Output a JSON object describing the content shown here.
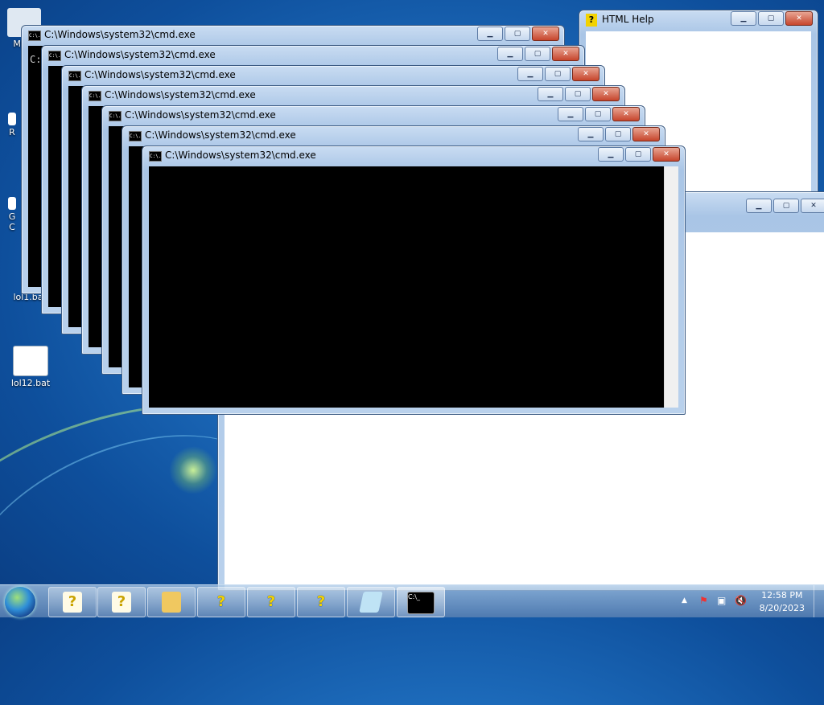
{
  "desktop": {
    "icons": [
      {
        "label": "My C"
      },
      {
        "label": "R"
      },
      {
        "label": "G"
      },
      {
        "label": "C"
      },
      {
        "label": "lol1.ba"
      },
      {
        "label": "lol12.bat"
      }
    ]
  },
  "cmd_windows": [
    {
      "title": "C:\\Windows\\system32\\cmd.exe",
      "prompt": "C:"
    },
    {
      "title": "C:\\Windows\\system32\\cmd.exe"
    },
    {
      "title": "C:\\Windows\\system32\\cmd.exe"
    },
    {
      "title": "C:\\Windows\\system32\\cmd.exe"
    },
    {
      "title": "C:\\Windows\\system32\\cmd.exe"
    },
    {
      "title": "C:\\Windows\\system32\\cmd.exe"
    },
    {
      "title": "C:\\Windows\\system32\\cmd.exe"
    }
  ],
  "html_help": {
    "title": "HTML Help"
  },
  "title_icon_text": "C:\\.",
  "colors": {
    "close_red": "#c7452c",
    "title_bg": "#b9d1ec",
    "console_bg": "#000000",
    "help_yellow": "#f2d200"
  },
  "taskbar": {
    "buttons": [
      {
        "icon": "help-file-icon",
        "glyph": "?"
      },
      {
        "icon": "help-file-icon",
        "glyph": "?"
      },
      {
        "icon": "file-explorer-icon",
        "glyph": ""
      },
      {
        "icon": "help-question-icon",
        "glyph": "?"
      },
      {
        "icon": "help-question-icon",
        "glyph": "?"
      },
      {
        "icon": "help-question-icon",
        "glyph": "?"
      },
      {
        "icon": "notepad-icon",
        "glyph": ""
      },
      {
        "icon": "cmd-icon",
        "glyph": "C:\\_"
      }
    ],
    "tray": {
      "time": "12:58 PM",
      "date": "8/20/2023",
      "arrow": "▲",
      "flag": "⚑",
      "network": "▣",
      "volume": "🔇"
    }
  }
}
